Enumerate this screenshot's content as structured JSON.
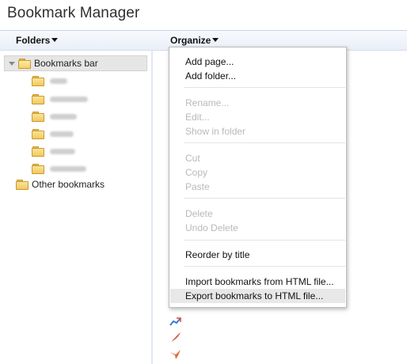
{
  "app": {
    "title": "Bookmark Manager"
  },
  "toolbar": {
    "folders_label": "Folders",
    "organize_label": "Organize"
  },
  "sidebar": {
    "bookmarks_bar_label": "Bookmarks bar",
    "other_bookmarks_label": "Other bookmarks",
    "blurred_folder_count": 6
  },
  "organize_menu": {
    "add_page": "Add page...",
    "add_folder": "Add folder...",
    "rename": "Rename...",
    "edit": "Edit...",
    "show_in_folder": "Show in folder",
    "cut": "Cut",
    "copy": "Copy",
    "paste": "Paste",
    "delete": "Delete",
    "undo_delete": "Undo Delete",
    "reorder_by_title": "Reorder by title",
    "import_html": "Import bookmarks from HTML file...",
    "export_html": "Export bookmarks to HTML file..."
  },
  "colors": {
    "accent": "#c8d3e6",
    "folder": "#f2c860",
    "disabled_text": "#b9b9b9"
  }
}
